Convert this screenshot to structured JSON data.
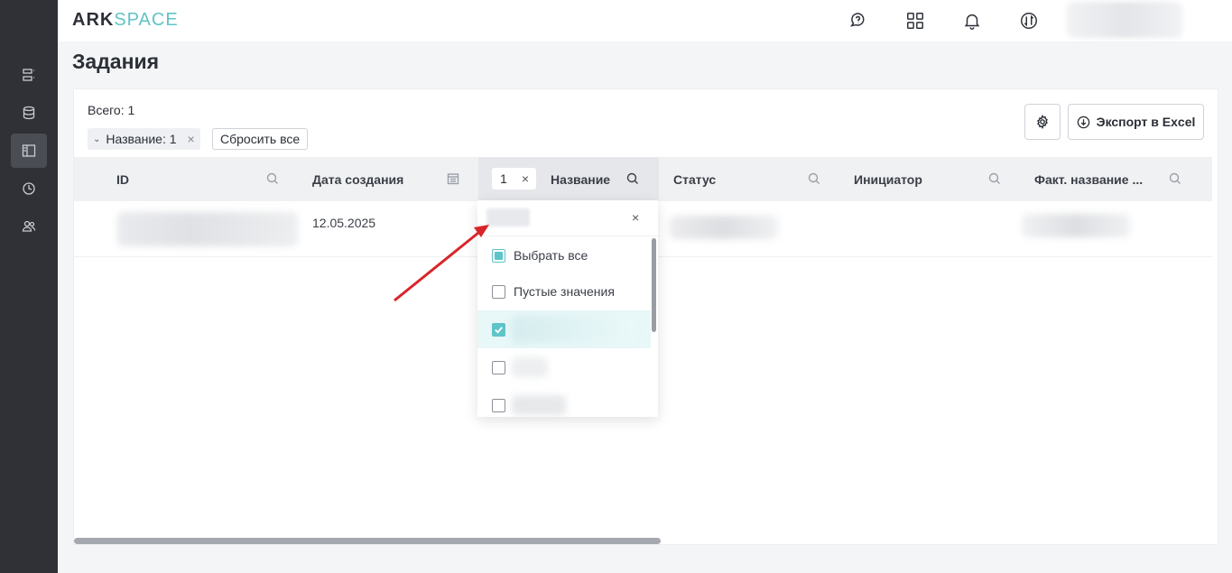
{
  "app": {
    "logo_ark": "ARK",
    "logo_space": "SPACE"
  },
  "sidebar": {
    "items": [
      {
        "icon": "list-icon",
        "active": false
      },
      {
        "icon": "database-icon",
        "active": false
      },
      {
        "icon": "tasks-panel-icon",
        "active": true
      },
      {
        "icon": "clock-icon",
        "active": false
      },
      {
        "icon": "users-icon",
        "active": false
      }
    ]
  },
  "header": {
    "icons": [
      "help-chat-icon",
      "apps-grid-icon",
      "bell-icon",
      "sync-icon"
    ]
  },
  "page": {
    "title": "Задания"
  },
  "toolbar": {
    "total": "Всего: 1",
    "filter_chip": "Название: 1",
    "reset_label": "Сбросить все",
    "export_label": "Экспорт в Excel"
  },
  "table": {
    "columns": [
      {
        "label": "ID"
      },
      {
        "label": "Дата создания"
      },
      {
        "label": "Название",
        "filter_count": "1"
      },
      {
        "label": "Статус"
      },
      {
        "label": "Инициатор"
      },
      {
        "label": "Факт. название ..."
      }
    ],
    "rows": [
      {
        "date": "12.05.2025"
      }
    ]
  },
  "filter_popup": {
    "clear": "×",
    "options": [
      {
        "label": "Выбрать все",
        "state": "partial"
      },
      {
        "label": "Пустые значения",
        "state": "unchecked"
      },
      {
        "label": "",
        "state": "checked"
      },
      {
        "label": "",
        "state": "unchecked"
      },
      {
        "label": "",
        "state": "unchecked"
      }
    ]
  },
  "colors": {
    "accent": "#5fc4c8",
    "sidebar": "#2f3136",
    "arrow": "#d9252a"
  }
}
